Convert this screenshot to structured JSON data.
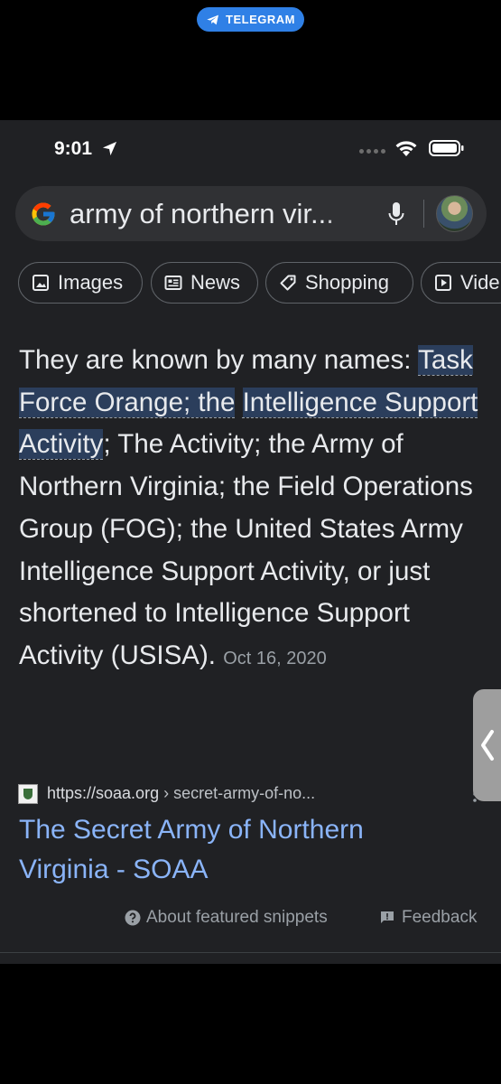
{
  "overlay": {
    "telegram_label": "TELEGRAM",
    "accent": "#2f80e6"
  },
  "status_bar": {
    "time": "9:01"
  },
  "search": {
    "query": "army of northern vir..."
  },
  "chips": [
    {
      "label": "Images",
      "icon": "image-icon"
    },
    {
      "label": "News",
      "icon": "news-icon"
    },
    {
      "label": "Shopping",
      "icon": "tag-icon"
    },
    {
      "label": "Vide",
      "icon": "play-icon"
    }
  ],
  "snippet": {
    "intro": "They are known by many names: ",
    "highlight_1": "Task Force Orange; the",
    "highlight_2": "Intelligence Support Activity",
    "body": "; The Activity; the Army of Northern Virginia; the Field Operations Group (FOG); the United States Army Intelligence Support Activity, or just shortened to Intelligence Support Activity (USISA).",
    "date": "Oct 16, 2020"
  },
  "result": {
    "domain": "https://soaa.org",
    "path": " › secret-army-of-no...",
    "title": "The Secret Army of Northern Virginia - SOAA",
    "link_color": "#8ab4f8"
  },
  "footer": {
    "about_label": "About featured snippets",
    "feedback_label": "Feedback"
  }
}
